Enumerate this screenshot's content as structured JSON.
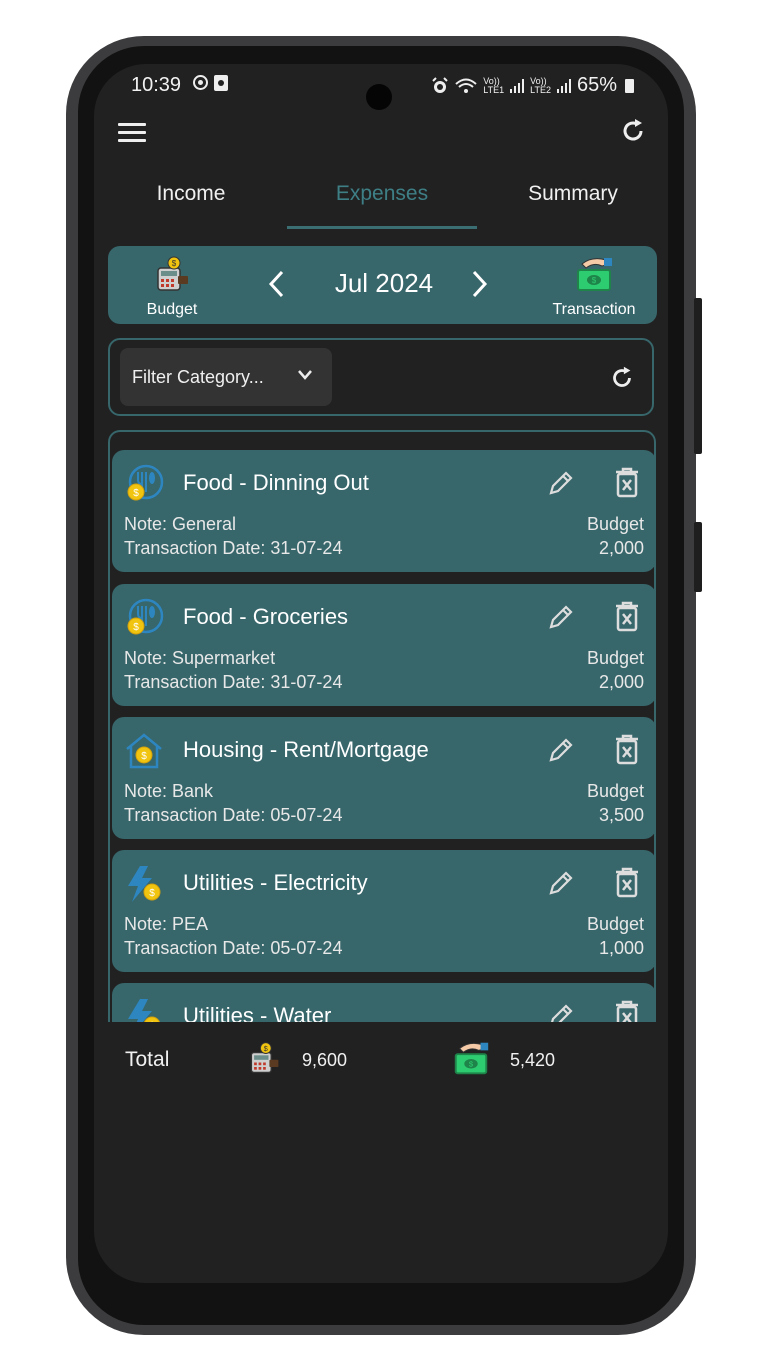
{
  "status_bar": {
    "time": "10:39",
    "battery": "65%",
    "net1": "Vo))\nLTE1",
    "net2": "Vo))\nLTE2"
  },
  "tabs": [
    {
      "label": "Income",
      "active": false
    },
    {
      "label": "Expenses",
      "active": true
    },
    {
      "label": "Summary",
      "active": false
    }
  ],
  "header": {
    "budget_label": "Budget",
    "month": "Jul 2024",
    "transaction_label": "Transaction"
  },
  "filter": {
    "placeholder": "Filter Category..."
  },
  "items": [
    {
      "title": "Food - Dinning Out",
      "icon": "food-dollar-icon",
      "note": "Note: General",
      "date": "Transaction Date: 31-07-24",
      "type": "Budget",
      "amount": "2,000"
    },
    {
      "title": "Food - Groceries",
      "icon": "food-dollar-icon",
      "note": "Note: Supermarket",
      "date": "Transaction Date: 31-07-24",
      "type": "Budget",
      "amount": "2,000"
    },
    {
      "title": "Housing - Rent/Mortgage",
      "icon": "house-dollar-icon",
      "note": "Note: Bank",
      "date": "Transaction Date: 05-07-24",
      "type": "Budget",
      "amount": "3,500"
    },
    {
      "title": "Utilities - Electricity",
      "icon": "electricity-dollar-icon",
      "note": "Note: PEA",
      "date": "Transaction Date: 05-07-24",
      "type": "Budget",
      "amount": "1,000"
    },
    {
      "title": "Utilities - Water",
      "icon": "electricity-dollar-icon",
      "note": "",
      "date": "",
      "type": "",
      "amount": ""
    }
  ],
  "totals": {
    "label": "Total",
    "budget_total": "9,600",
    "transaction_total": "5,420"
  },
  "colors": {
    "accent": "#37666b",
    "active_tab": "#3e7f86",
    "background": "#212121"
  }
}
